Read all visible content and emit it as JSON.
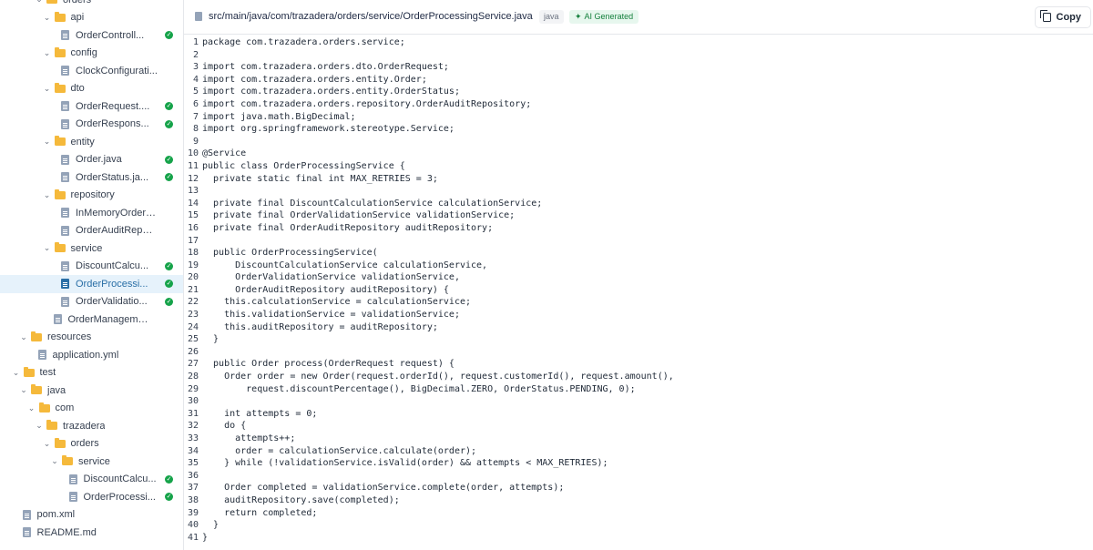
{
  "sidebar": {
    "items": [
      {
        "label": "orders",
        "kind": "folder",
        "depth": 4,
        "open": true
      },
      {
        "label": "api",
        "kind": "folder",
        "depth": 5,
        "open": true
      },
      {
        "label": "OrderControll...",
        "kind": "file",
        "depth": 6,
        "check": true
      },
      {
        "label": "config",
        "kind": "folder",
        "depth": 5,
        "open": true
      },
      {
        "label": "ClockConfigurati...",
        "kind": "file",
        "depth": 6
      },
      {
        "label": "dto",
        "kind": "folder",
        "depth": 5,
        "open": true
      },
      {
        "label": "OrderRequest....",
        "kind": "file",
        "depth": 6,
        "check": true
      },
      {
        "label": "OrderRespons...",
        "kind": "file",
        "depth": 6,
        "check": true
      },
      {
        "label": "entity",
        "kind": "folder",
        "depth": 5,
        "open": true
      },
      {
        "label": "Order.java",
        "kind": "file",
        "depth": 6,
        "check": true
      },
      {
        "label": "OrderStatus.ja...",
        "kind": "file",
        "depth": 6,
        "check": true
      },
      {
        "label": "repository",
        "kind": "folder",
        "depth": 5,
        "open": true
      },
      {
        "label": "InMemoryOrderA...",
        "kind": "file",
        "depth": 6
      },
      {
        "label": "OrderAuditReposi...",
        "kind": "file",
        "depth": 6
      },
      {
        "label": "service",
        "kind": "folder",
        "depth": 5,
        "open": true
      },
      {
        "label": "DiscountCalcu...",
        "kind": "file",
        "depth": 6,
        "check": true
      },
      {
        "label": "OrderProcessi...",
        "kind": "file",
        "depth": 6,
        "check": true,
        "selected": true
      },
      {
        "label": "OrderValidatio...",
        "kind": "file",
        "depth": 6,
        "check": true
      },
      {
        "label": "OrderManagement...",
        "kind": "file",
        "depth": 5
      },
      {
        "label": "resources",
        "kind": "folder",
        "depth": 2,
        "open": true
      },
      {
        "label": "application.yml",
        "kind": "file",
        "depth": 3
      },
      {
        "label": "test",
        "kind": "folder",
        "depth": 1,
        "open": true
      },
      {
        "label": "java",
        "kind": "folder",
        "depth": 2,
        "open": true
      },
      {
        "label": "com",
        "kind": "folder",
        "depth": 3,
        "open": true
      },
      {
        "label": "trazadera",
        "kind": "folder",
        "depth": 4,
        "open": true
      },
      {
        "label": "orders",
        "kind": "folder",
        "depth": 5,
        "open": true
      },
      {
        "label": "service",
        "kind": "folder",
        "depth": 6,
        "open": true
      },
      {
        "label": "DiscountCalcu...",
        "kind": "file",
        "depth": 7,
        "check": true
      },
      {
        "label": "OrderProcessi...",
        "kind": "file",
        "depth": 7,
        "check": true
      },
      {
        "label": "pom.xml",
        "kind": "file",
        "depth": 1
      },
      {
        "label": "README.md",
        "kind": "file",
        "depth": 1
      }
    ]
  },
  "header": {
    "path": "src/main/java/com/trazadera/orders/service/OrderProcessingService.java",
    "language": "java",
    "ai_badge": "AI Generated",
    "copy_label": "Copy"
  },
  "code": {
    "lines": [
      "package com.trazadera.orders.service;",
      "",
      "import com.trazadera.orders.dto.OrderRequest;",
      "import com.trazadera.orders.entity.Order;",
      "import com.trazadera.orders.entity.OrderStatus;",
      "import com.trazadera.orders.repository.OrderAuditRepository;",
      "import java.math.BigDecimal;",
      "import org.springframework.stereotype.Service;",
      "",
      "@Service",
      "public class OrderProcessingService {",
      "  private static final int MAX_RETRIES = 3;",
      "",
      "  private final DiscountCalculationService calculationService;",
      "  private final OrderValidationService validationService;",
      "  private final OrderAuditRepository auditRepository;",
      "",
      "  public OrderProcessingService(",
      "      DiscountCalculationService calculationService,",
      "      OrderValidationService validationService,",
      "      OrderAuditRepository auditRepository) {",
      "    this.calculationService = calculationService;",
      "    this.validationService = validationService;",
      "    this.auditRepository = auditRepository;",
      "  }",
      "",
      "  public Order process(OrderRequest request) {",
      "    Order order = new Order(request.orderId(), request.customerId(), request.amount(),",
      "        request.discountPercentage(), BigDecimal.ZERO, OrderStatus.PENDING, 0);",
      "",
      "    int attempts = 0;",
      "    do {",
      "      attempts++;",
      "      order = calculationService.calculate(order);",
      "    } while (!validationService.isValid(order) && attempts < MAX_RETRIES);",
      "",
      "    Order completed = validationService.complete(order, attempts);",
      "    auditRepository.save(completed);",
      "    return completed;",
      "  }",
      "}"
    ]
  }
}
